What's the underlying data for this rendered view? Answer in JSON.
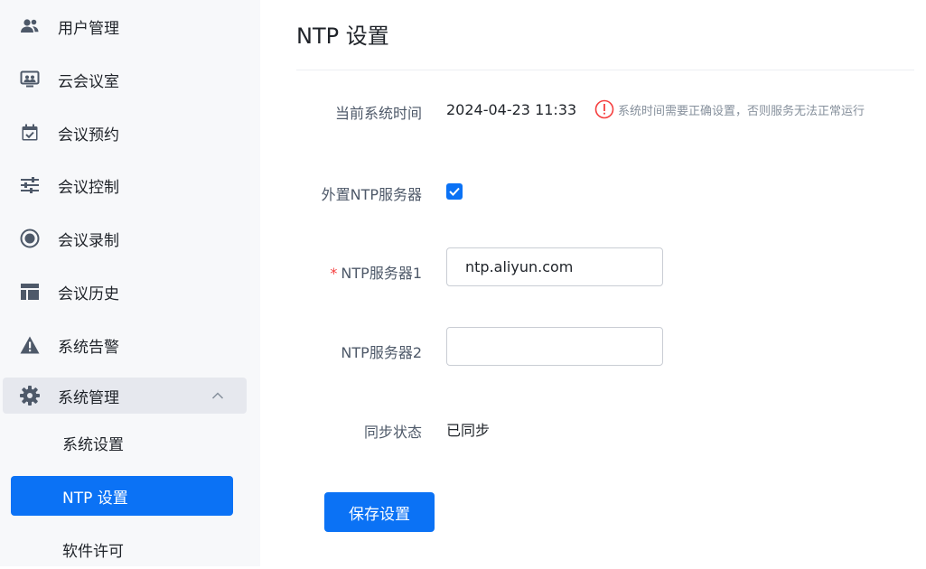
{
  "sidebar": {
    "items": [
      {
        "label": "用户管理",
        "icon": "users-icon"
      },
      {
        "label": "云会议室",
        "icon": "meeting-room-icon"
      },
      {
        "label": "会议预约",
        "icon": "calendar-check-icon"
      },
      {
        "label": "会议控制",
        "icon": "sliders-icon"
      },
      {
        "label": "会议录制",
        "icon": "record-icon"
      },
      {
        "label": "会议历史",
        "icon": "history-layout-icon"
      },
      {
        "label": "系统告警",
        "icon": "warning-icon"
      },
      {
        "label": "系统管理",
        "icon": "gear-icon",
        "expanded": true
      }
    ],
    "sub_items": [
      {
        "label": "系统设置"
      },
      {
        "label": "NTP 设置",
        "selected": true
      },
      {
        "label": "软件许可"
      }
    ]
  },
  "page": {
    "title": "NTP 设置",
    "current_time_label": "当前系统时间",
    "current_time_value": "2024-04-23 11:33",
    "time_hint": "系统时间需要正确设置，否则服务无法正常运行",
    "external_ntp_label": "外置NTP服务器",
    "external_ntp_checked": true,
    "ntp1_required": "*",
    "ntp1_label": "NTP服务器1",
    "ntp1_value": "ntp.aliyun.com",
    "ntp2_label": "NTP服务器2",
    "ntp2_value": "",
    "sync_label": "同步状态",
    "sync_value": "已同步",
    "save_label": "保存设置"
  },
  "colors": {
    "primary": "#0b72f5",
    "warning": "#f53f3f",
    "sidebar_bg": "#f7f8fa"
  }
}
